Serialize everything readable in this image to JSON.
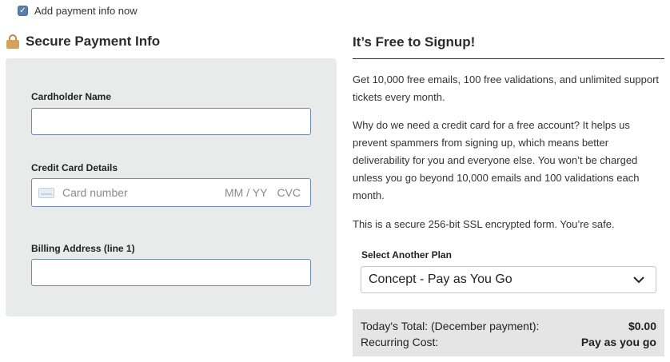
{
  "top_checkbox": {
    "label": "Add payment info now",
    "checked": true,
    "check_glyph": "✓"
  },
  "left": {
    "title": "Secure Payment Info",
    "lock_icon": "lock-icon",
    "cardholder_label": "Cardholder Name",
    "cardholder_value": "",
    "card_label": "Credit Card Details",
    "card_number_placeholder": "Card number",
    "card_expiry_placeholder": "MM / YY",
    "card_cvc_placeholder": "CVC",
    "billing_label": "Billing Address (line 1)",
    "billing_value": ""
  },
  "right": {
    "title": "It’s Free to Signup!",
    "para1": "Get 10,000 free emails, 100 free validations, and unlimited support tickets every month.",
    "para2": "Why do we need a credit card for a free account? It helps us prevent spammers from signing up, which means better deliverability for you and everyone else. You won’t be charged unless you go beyond 10,000 emails and 100 validations each month.",
    "para3": "This is a secure 256-bit SSL encrypted form. You’re safe.",
    "plan_label": "Select Another Plan",
    "plan_selected": "Concept - Pay as You Go",
    "totals": {
      "today_label": "Today's Total: (December payment):",
      "today_value": "$0.00",
      "recurring_label": "Recurring Cost:",
      "recurring_value": "Pay as you go"
    }
  },
  "colors": {
    "panel_bg": "#e9ebea",
    "input_border": "#6f8db0",
    "checkbox": "#5b7fa6",
    "lock": "#d2a35d",
    "totals_bg": "#e4e5e4"
  }
}
